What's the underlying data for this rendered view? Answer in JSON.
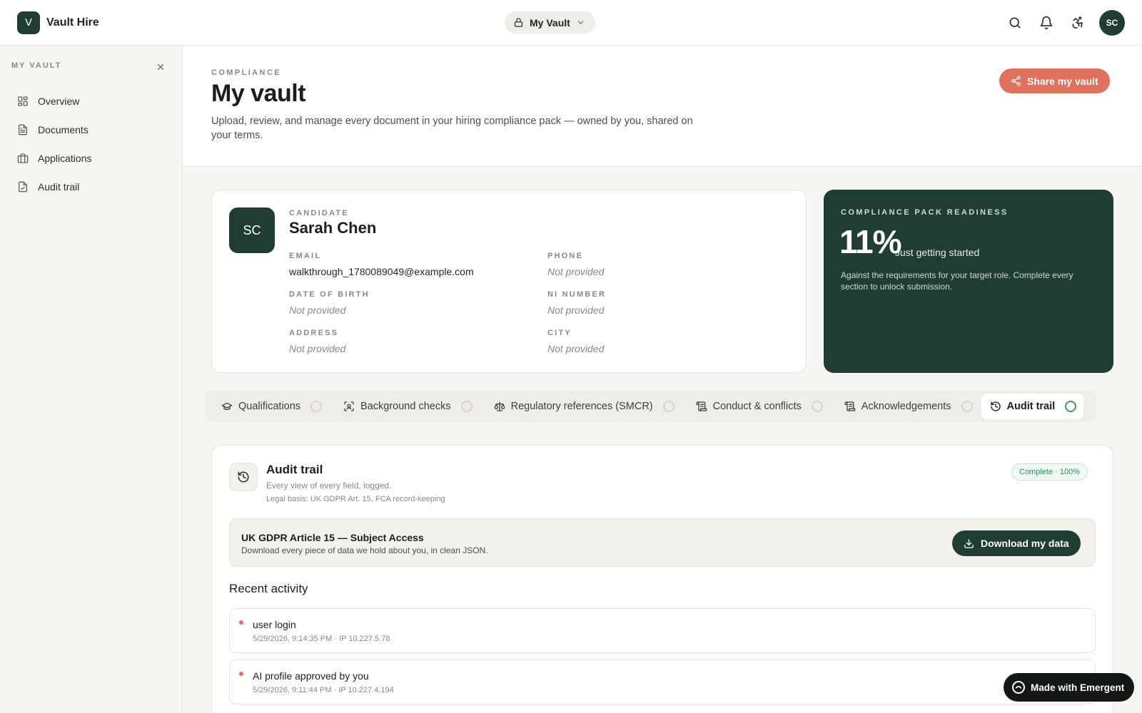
{
  "app": {
    "logo_letter": "V",
    "name": "Vault Hire"
  },
  "topbar": {
    "vault_switch_label": "My Vault",
    "user_initials": "SC"
  },
  "sidebar": {
    "heading": "MY VAULT",
    "items": [
      {
        "label": "Overview",
        "icon": "grid-icon"
      },
      {
        "label": "Documents",
        "icon": "document-icon"
      },
      {
        "label": "Applications",
        "icon": "briefcase-icon"
      },
      {
        "label": "Audit trail",
        "icon": "file-check-icon"
      }
    ]
  },
  "header": {
    "eyebrow": "COMPLIANCE",
    "title": "My vault",
    "description": "Upload, review, and manage every document in your hiring compliance pack — owned by you, shared on your terms.",
    "share_label": "Share my vault"
  },
  "candidate": {
    "initials": "SC",
    "label": "CANDIDATE",
    "name": "Sarah Chen",
    "email_label": "EMAIL",
    "email": "walkthrough_1780089049@example.com",
    "phone_label": "PHONE",
    "phone": "Not provided",
    "dob_label": "DATE OF BIRTH",
    "dob": "Not provided",
    "ni_label": "NI NUMBER",
    "ni": "Not provided",
    "address_label": "ADDRESS",
    "address": "Not provided",
    "city_label": "CITY",
    "city": "Not provided"
  },
  "readiness": {
    "label": "COMPLIANCE PACK READINESS",
    "percent": "11%",
    "status": "Just getting started",
    "description": "Against the requirements for your target role. Complete every section to unlock submission."
  },
  "tabs": [
    {
      "label": "Qualifications",
      "icon": "graduation-cap-icon"
    },
    {
      "label": "Background checks",
      "icon": "scan-face-icon"
    },
    {
      "label": "Regulatory references (SMCR)",
      "icon": "scale-icon"
    },
    {
      "label": "Conduct & conflicts",
      "icon": "scroll-icon"
    },
    {
      "label": "Acknowledgements",
      "icon": "scroll-icon"
    },
    {
      "label": "Audit trail",
      "icon": "history-icon",
      "active": true
    }
  ],
  "audit": {
    "title": "Audit trail",
    "subtitle": "Every view of every field, logged.",
    "legal_basis": "Legal basis: UK GDPR Art. 15, FCA record-keeping",
    "badge": "Complete · 100%",
    "gdpr_title": "UK GDPR Article 15 — Subject Access",
    "gdpr_sub": "Download every piece of data we hold about you, in clean JSON.",
    "download_label": "Download my data",
    "recent_title": "Recent activity",
    "activity": [
      {
        "title": "user login",
        "meta": "5/29/2026, 9:14:35 PM · IP 10.227.5.78"
      },
      {
        "title": "AI profile approved by you",
        "meta": "5/29/2026, 9:11:44 PM · IP 10.227.4.194"
      }
    ]
  },
  "floating_badge": {
    "label": "Made with Emergent"
  },
  "colors": {
    "accent": "#e0715c",
    "brand": "#1f3d33",
    "success": "#3a9a6a",
    "background": "#f7f5f1"
  }
}
